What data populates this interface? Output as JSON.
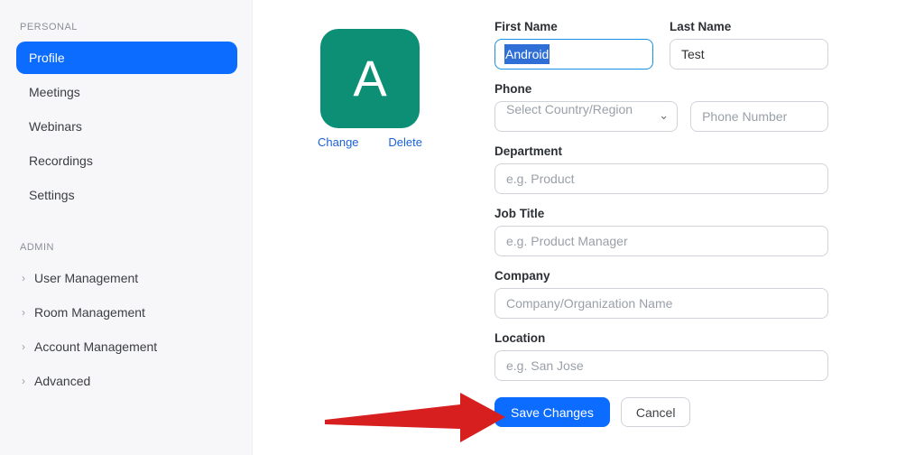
{
  "sidebar": {
    "personal_label": "PERSONAL",
    "admin_label": "ADMIN",
    "personal": [
      {
        "label": "Profile",
        "active": true
      },
      {
        "label": "Meetings"
      },
      {
        "label": "Webinars"
      },
      {
        "label": "Recordings"
      },
      {
        "label": "Settings"
      }
    ],
    "admin": [
      {
        "label": "User Management"
      },
      {
        "label": "Room Management"
      },
      {
        "label": "Account Management"
      },
      {
        "label": "Advanced"
      }
    ]
  },
  "avatar": {
    "letter": "A",
    "change": "Change",
    "delete": "Delete"
  },
  "form": {
    "first_name": {
      "label": "First Name",
      "value": "Android"
    },
    "last_name": {
      "label": "Last Name",
      "value": "Test"
    },
    "phone": {
      "label": "Phone",
      "select_placeholder": "Select Country/Region",
      "number_placeholder": "Phone Number"
    },
    "department": {
      "label": "Department",
      "placeholder": "e.g. Product"
    },
    "job_title": {
      "label": "Job Title",
      "placeholder": "e.g. Product Manager"
    },
    "company": {
      "label": "Company",
      "placeholder": "Company/Organization Name"
    },
    "location": {
      "label": "Location",
      "placeholder": "e.g. San Jose"
    }
  },
  "actions": {
    "save": "Save Changes",
    "cancel": "Cancel"
  }
}
